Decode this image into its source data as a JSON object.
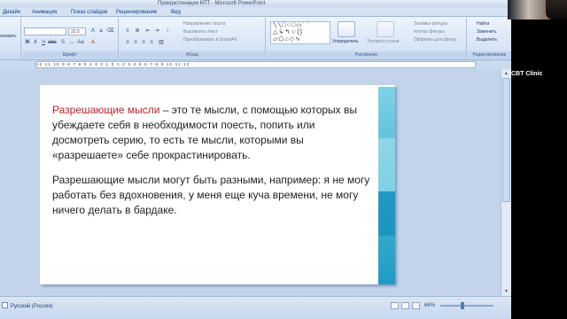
{
  "window": {
    "title": "Прокрастинация КПТ - Microsoft PowerPoint"
  },
  "tabs": [
    "Дизайн",
    "Анимация",
    "Показ слайдов",
    "Рецензирование",
    "Вид"
  ],
  "ribbon": {
    "font_size": "22,5",
    "left_edge_label": "ановить",
    "direction_label": "Направление текста",
    "align_label": "Выровнять текст",
    "smartart_label": "Преобразовать в SmartArt",
    "arrange_label": "Упорядочить",
    "quick_styles_label": "Экспресс-стили",
    "fill_label": "Заливка фигуры",
    "outline_label": "Контур фигуры",
    "effects_label": "Эффекты для фигур",
    "find_label": "Найти",
    "replace_label": "Заменить",
    "select_label": "Выделить",
    "groups": {
      "font": "Шрифт",
      "paragraph": "Абзац",
      "drawing": "Рисование",
      "editing": "Редактирование"
    }
  },
  "ruler": {
    "numbers": "12·11·10·9·8·7·6·5·4·3·2·1·0·1·2·3·4·5·6·7·8·9·10·11·12"
  },
  "slide": {
    "highlight": "Разрешающие мысли",
    "para1_rest": " – это те мысли, с помощью которых вы убеждаете себя в необходимости поесть, попить или досмотреть серию, то есть те мысли, которыми вы «разрешаете» себе прокрастинировать.",
    "para2": "Разрешающие мысли могут быть разными, например: я не могу работать без вдохновения, у меня еще куча времени, не могу ничего делать в бардаке."
  },
  "status": {
    "language": "Русский (Россия)",
    "zoom": "64%",
    "zoom_fraction": 0.42
  },
  "webcam": {
    "label": "CBT Clinic"
  },
  "colors": {
    "highlight": "#c0202a",
    "accent_stripe": "#1e9cc5"
  }
}
